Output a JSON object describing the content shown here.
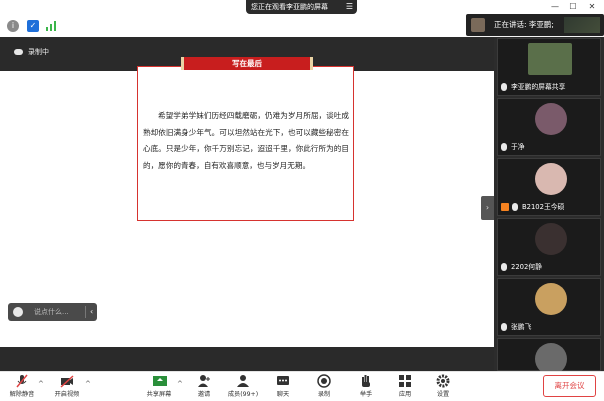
{
  "window": {
    "viewing_text": "您正在观看李亚鹏的屏幕",
    "menu_glyph": "☰",
    "minimize": "—",
    "maximize": "☐",
    "close": "✕"
  },
  "speaking": {
    "label": "正在讲话: 李亚鹏;"
  },
  "recording": {
    "label": "录制中"
  },
  "slide": {
    "banner_title": "写在最后",
    "body": "希望学弟学妹们历经四载磨砺，仍难为岁月所屈，谈吐成熟却依旧满身少年气。可以坦然站在光下，也可以藏些秘密在心底。只是少年，你千万别忘记，迢迢千里，你此行所为的目的，愿你的青春，自有欢喜顺意，也与岁月无期。"
  },
  "chat": {
    "placeholder": "说点什么...",
    "chevron": "‹"
  },
  "rail": {
    "collapse_glyph": "›",
    "participants": [
      {
        "name": "李亚鹏的屏幕共享",
        "color": "#5a6f4a"
      },
      {
        "name": "于净",
        "color": "#7a5a6a"
      },
      {
        "name": "B2102王今硕",
        "color": "#d9b8b0",
        "highlight": true
      },
      {
        "name": "2202何静",
        "color": "#3a3030"
      },
      {
        "name": "张鹏飞",
        "color": "#c9a060"
      },
      {
        "name": "",
        "color": "#6a6a6a"
      }
    ]
  },
  "controls": {
    "items": [
      {
        "label": "解除静音",
        "icon": "mic-muted-icon",
        "glyph": "🎙"
      },
      {
        "label": "开启视频",
        "icon": "video-off-icon",
        "glyph": "■"
      },
      {
        "label": "共享屏幕",
        "icon": "share-screen-icon",
        "glyph": "▣"
      },
      {
        "label": "邀请",
        "icon": "invite-icon",
        "glyph": "●"
      },
      {
        "label": "成员(99+)",
        "icon": "members-icon",
        "glyph": "●"
      },
      {
        "label": "聊天",
        "icon": "chat-icon",
        "glyph": "▤"
      },
      {
        "label": "录制",
        "icon": "record-icon",
        "glyph": "◉"
      },
      {
        "label": "举手",
        "icon": "raise-hand-icon",
        "glyph": "✋"
      },
      {
        "label": "应用",
        "icon": "apps-icon",
        "glyph": "▦"
      },
      {
        "label": "设置",
        "icon": "settings-icon",
        "glyph": "⚙"
      }
    ],
    "caret": "^",
    "leave_label": "离开会议"
  },
  "colors": {
    "accent_red": "#c81e1e",
    "leave_red": "#e04343",
    "rail_bg": "#2c2c2c"
  }
}
